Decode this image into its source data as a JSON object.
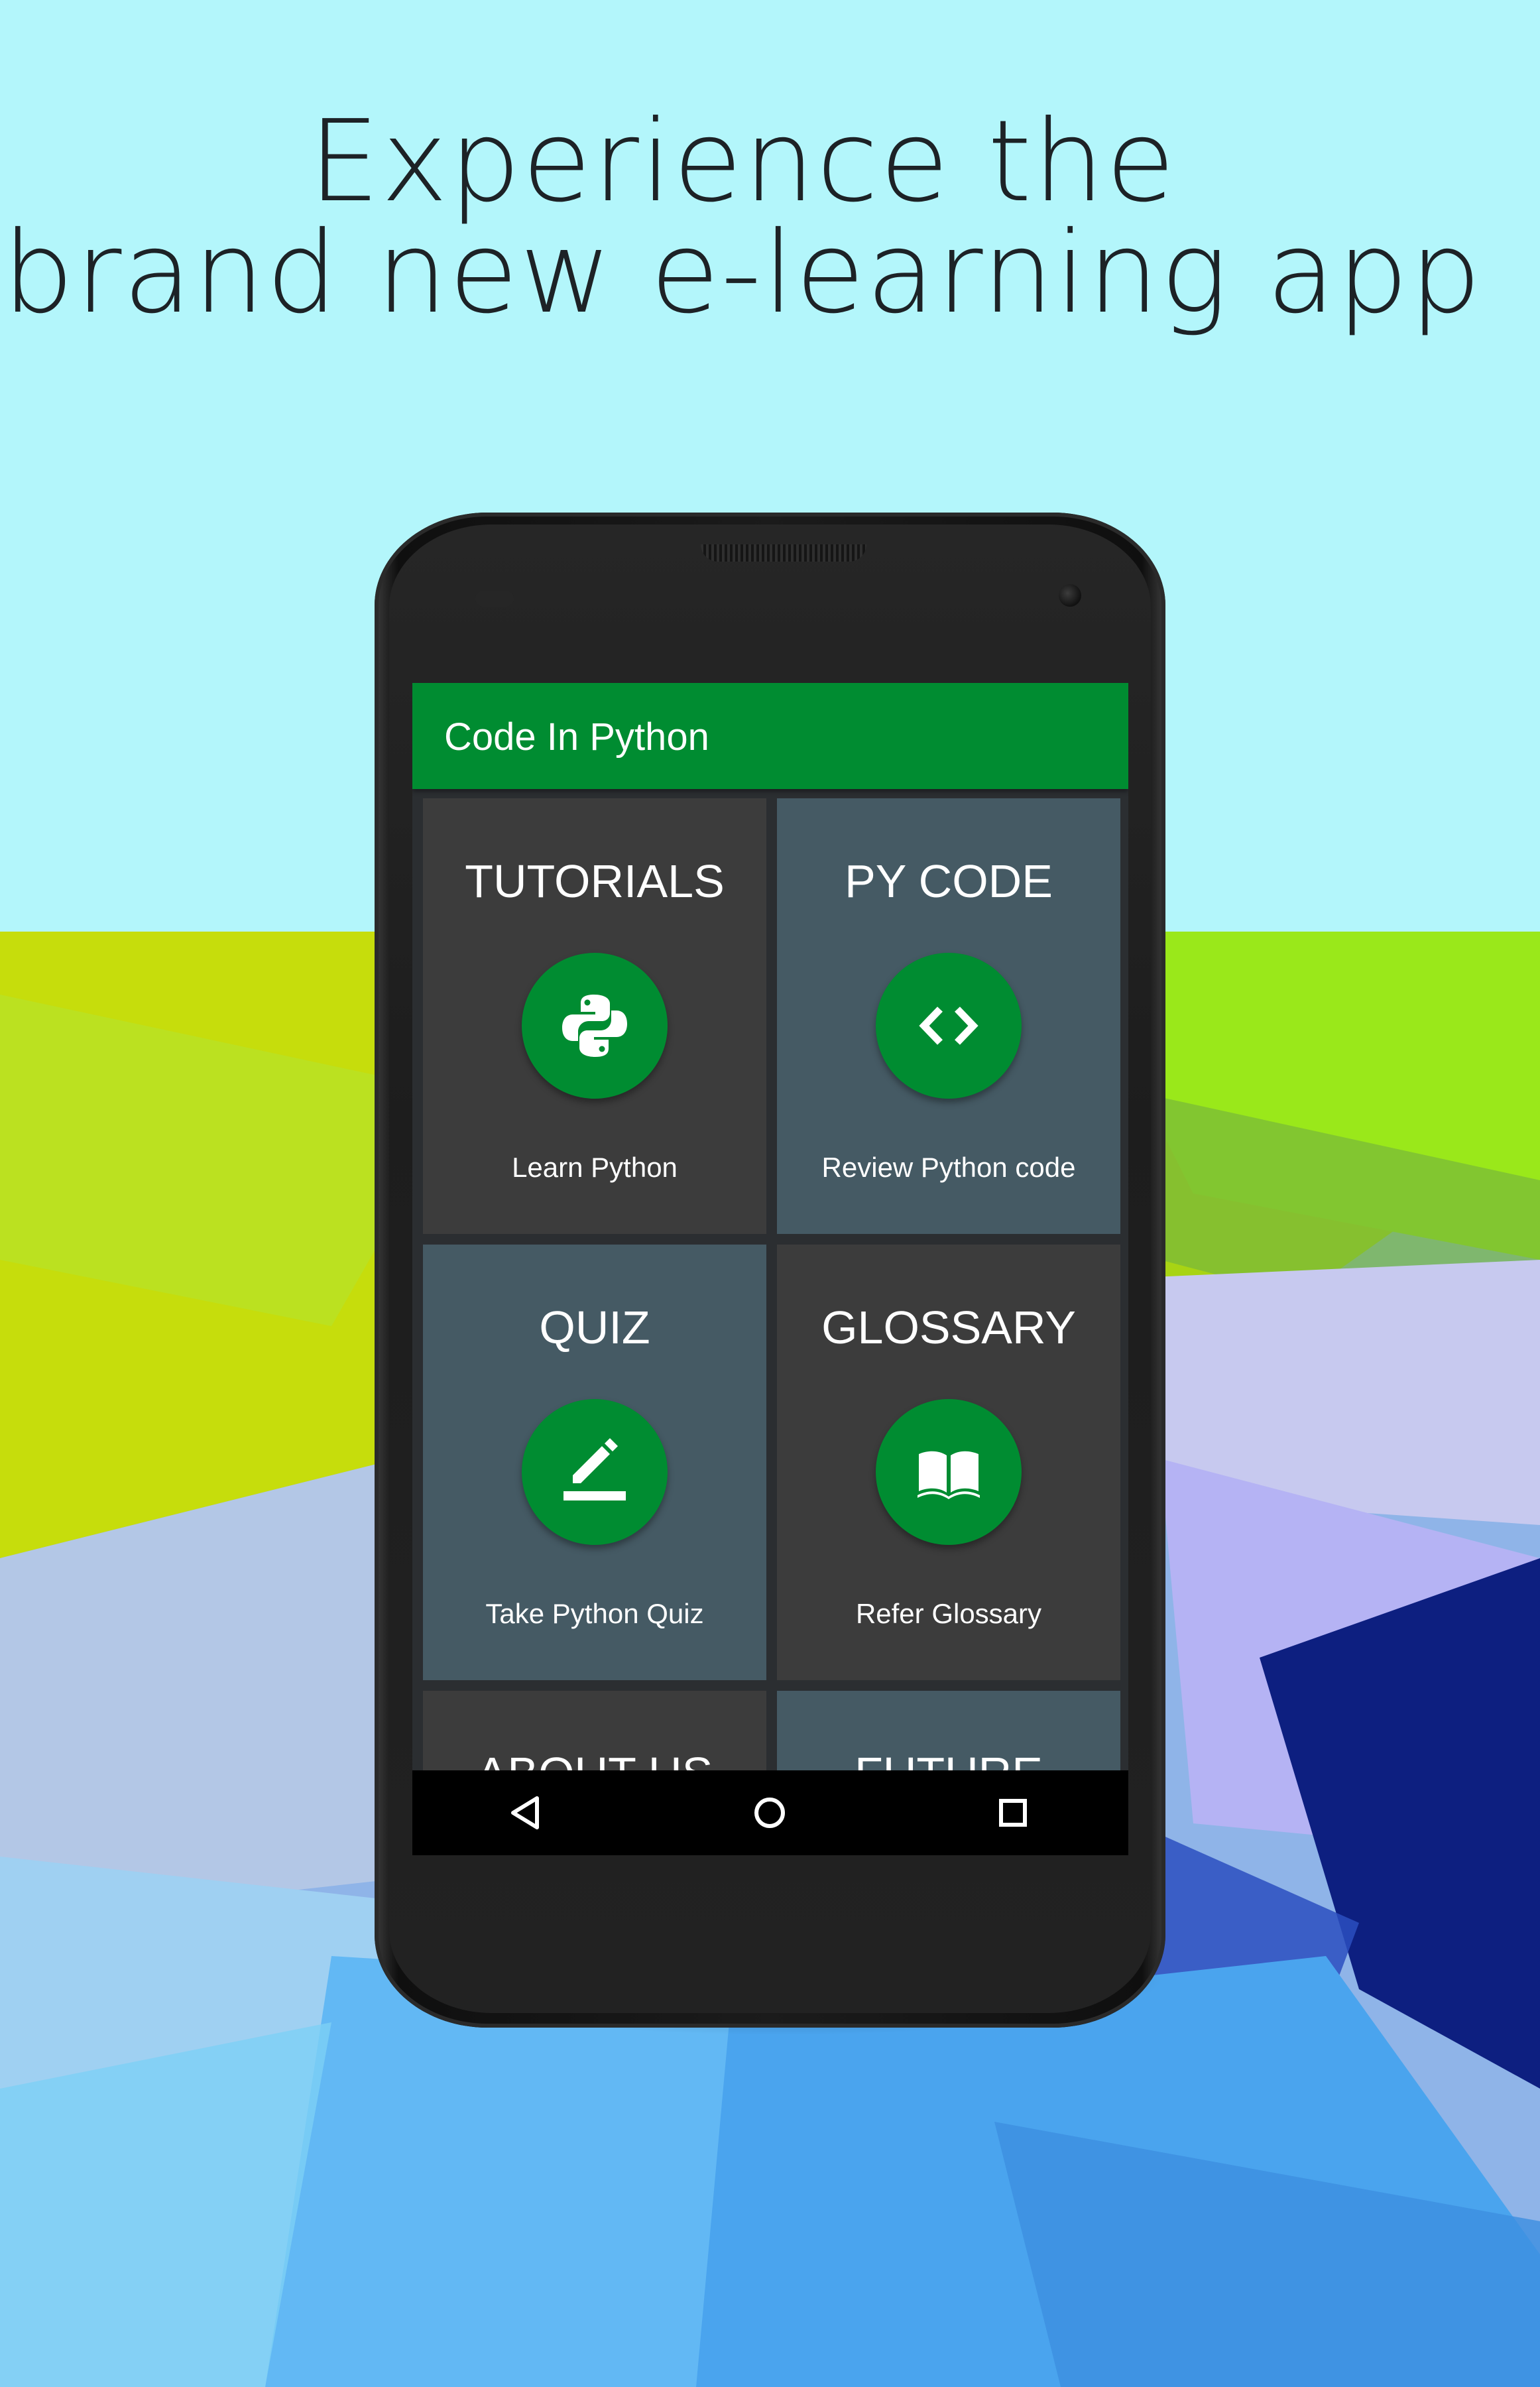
{
  "headline": {
    "line1": "Experience the",
    "line2": "brand new e-learning app"
  },
  "app": {
    "title": "Code In Python",
    "accent_color": "#008c31",
    "tiles": [
      {
        "title": "TUTORIALS",
        "subtitle": "Learn Python",
        "icon": "python-logo-icon",
        "color": "#3c3c3c"
      },
      {
        "title": "PY CODE",
        "subtitle": "Review Python code",
        "icon": "code-brackets-icon",
        "color": "#455a64"
      },
      {
        "title": "QUIZ",
        "subtitle": "Take Python Quiz",
        "icon": "pencil-edit-icon",
        "color": "#455a64"
      },
      {
        "title": "GLOSSARY",
        "subtitle": "Refer Glossary",
        "icon": "open-book-icon",
        "color": "#3c3c3c"
      },
      {
        "title": "ABOUT US",
        "subtitle": "",
        "icon": "",
        "color": "#3c3c3c"
      },
      {
        "title": "FUTURE",
        "subtitle": "",
        "icon": "",
        "color": "#455a64"
      }
    ]
  },
  "navbar": {
    "back": "back-triangle-icon",
    "home": "home-circle-icon",
    "recents": "recents-square-icon"
  }
}
